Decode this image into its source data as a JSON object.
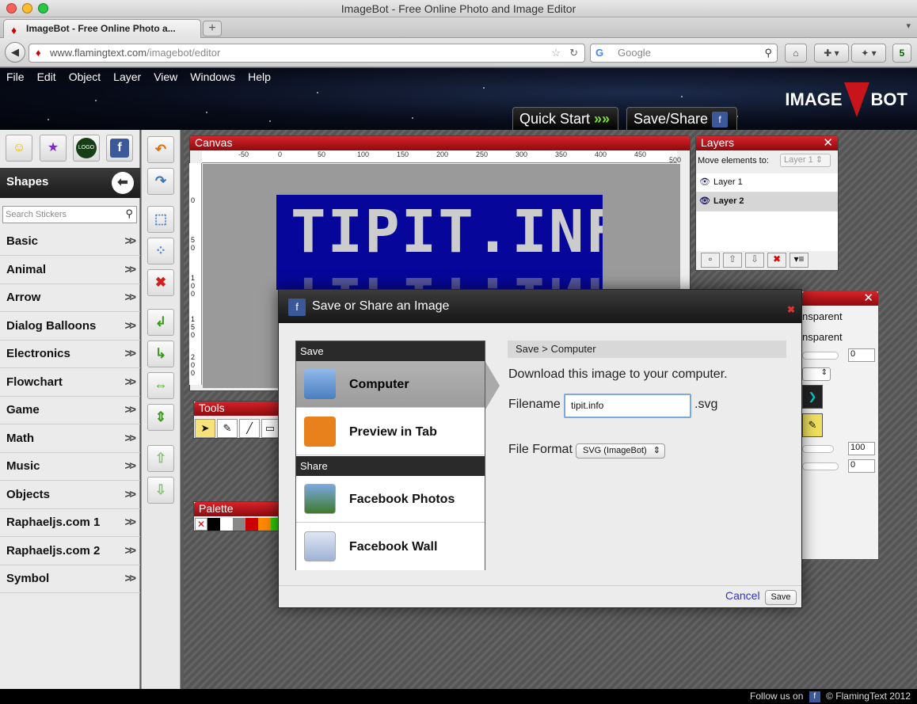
{
  "browser": {
    "window_title": "ImageBot - Free Online Photo and Image Editor",
    "tab_title": "ImageBot - Free Online Photo a...",
    "url_domain": "www.flamingtext.com",
    "url_path": "/imagebot/editor",
    "search_placeholder": "Google",
    "addons_count": "5"
  },
  "app": {
    "menu": [
      "File",
      "Edit",
      "Object",
      "Layer",
      "View",
      "Windows",
      "Help"
    ],
    "quick_start": "Quick Start",
    "save_share": "Save/Share",
    "logo_left": "IMAGE",
    "logo_right": "BOT"
  },
  "sidebar": {
    "shapes_title": "Shapes",
    "search_placeholder": "Search Stickers",
    "logo_button": "LOGO",
    "categories": [
      "Basic",
      "Animal",
      "Arrow",
      "Dialog Balloons",
      "Electronics",
      "Flowchart",
      "Game",
      "Math",
      "Music",
      "Objects",
      "Raphaeljs.com 1",
      "Raphaeljs.com 2",
      "Symbol"
    ]
  },
  "canvas": {
    "title": "Canvas",
    "ruler_h": [
      "-50",
      "0",
      "50",
      "100",
      "150",
      "200",
      "250",
      "300",
      "350",
      "400",
      "450",
      "500"
    ],
    "ruler_v": [
      "0",
      "5 0",
      "1 0 0",
      "1 5 0",
      "2 0 0"
    ],
    "art_text": "TIPIT.INFO"
  },
  "tools": {
    "title": "Tools"
  },
  "palette": {
    "title": "Palette"
  },
  "layers": {
    "title": "Layers",
    "move_label": "Move elements to:",
    "move_value": "Layer 1",
    "items": [
      "Layer 1",
      "Layer 2"
    ]
  },
  "properties": {
    "text1": "nsparent",
    "text2": "nsparent",
    "value1": "0",
    "value2": "100",
    "value3": "0"
  },
  "dialog": {
    "title": "Save or Share an Image",
    "group_save": "Save",
    "item_computer": "Computer",
    "item_preview": "Preview in Tab",
    "group_share": "Share",
    "item_fb_photos": "Facebook Photos",
    "item_fb_wall": "Facebook Wall",
    "breadcrumb": "Save > Computer",
    "description": "Download this image to your computer.",
    "filename_label": "Filename",
    "filename_value": "tipit.info",
    "extension": ".svg",
    "format_label": "File Format",
    "format_value": "SVG (ImageBot)",
    "cancel": "Cancel",
    "save": "Save"
  },
  "footer": {
    "follow": "Follow us on",
    "copyright": "© FlamingText 2012"
  },
  "colors": {
    "accent_red": "#c8141b",
    "canvas_blue": "#06079a",
    "link_blue": "#3333cc"
  }
}
